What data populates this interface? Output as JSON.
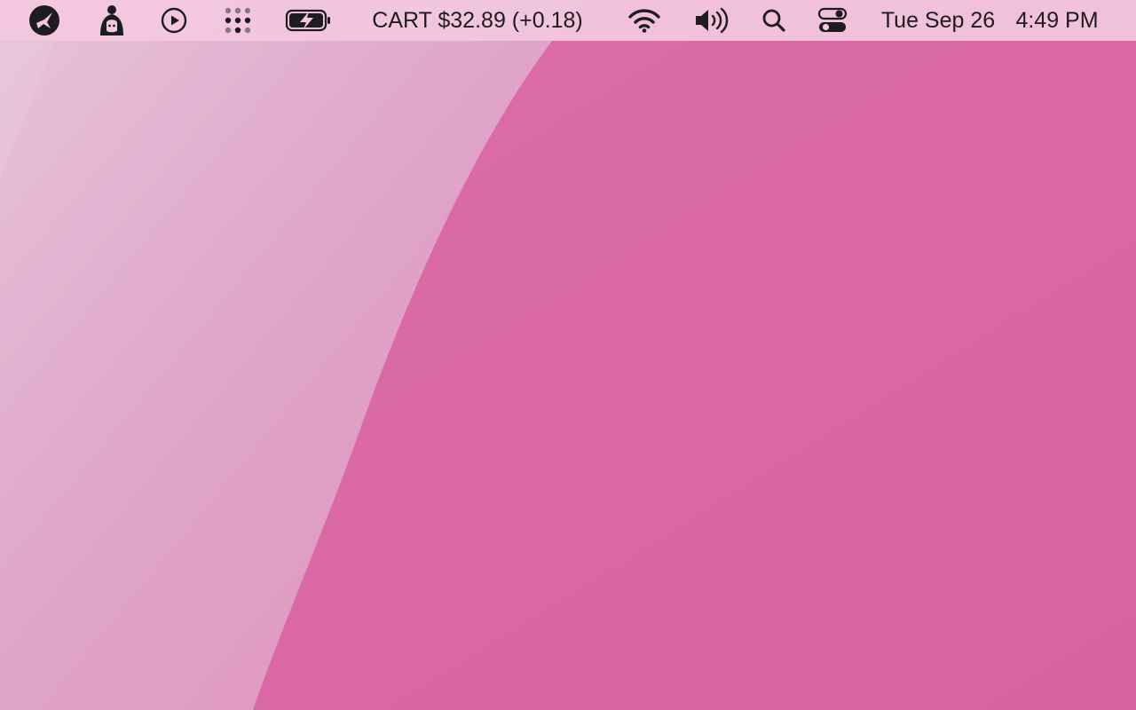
{
  "menubar": {
    "status_icons": [
      {
        "icon": "bird-logo-icon"
      },
      {
        "icon": "character-mascot-icon"
      },
      {
        "icon": "play-circle-icon"
      },
      {
        "icon": "dots-grid-icon"
      },
      {
        "icon": "battery-charging-icon"
      }
    ],
    "stock_ticker": "CART $32.89 (+0.18)",
    "system_icons": [
      {
        "icon": "wifi-icon"
      },
      {
        "icon": "volume-icon"
      },
      {
        "icon": "search-icon"
      },
      {
        "icon": "control-center-icon"
      }
    ],
    "date": "Tue Sep 26",
    "time": "4:49 PM"
  },
  "colors": {
    "menubar_bg": "#f3c8e0",
    "wallpaper_main": "#d866a0",
    "wallpaper_light": "#e6aed0",
    "icon": "#1d1d1f"
  }
}
